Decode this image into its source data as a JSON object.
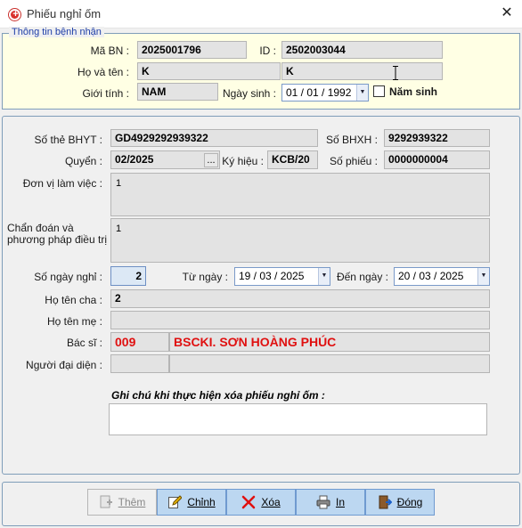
{
  "window": {
    "title": "Phiếu nghỉ ốm",
    "close_glyph": "✕",
    "icon": "medical-cross-icon"
  },
  "patient": {
    "legend": "Thông tin bệnh nhận",
    "ma_bn_label": "Mã BN :",
    "ma_bn": "2025001796",
    "id_label": "ID :",
    "id": "2502003044",
    "ho_ten_label": "Họ và tên :",
    "ho": "K",
    "ten": "K",
    "gioi_tinh_label": "Giới tính :",
    "gioi_tinh": "NAM",
    "ngay_sinh_label": "Ngày sinh :",
    "ngay_sinh": "01 / 01 / 1992",
    "nam_sinh_label": "Năm sinh"
  },
  "details": {
    "so_the_bhyt_label": "Số thẻ BHYT :",
    "so_the_bhyt": "GD4929292939322",
    "so_bhxh_label": "Số BHXH :",
    "so_bhxh": "9292939322",
    "quyen_label": "Quyển :",
    "quyen": "02/2025",
    "dots": "...",
    "ky_hieu_label": "Ký hiệu :",
    "ky_hieu": "KCB/20",
    "so_phieu_label": "Số phiếu :",
    "so_phieu": "0000000004",
    "don_vi_label": "Đơn vị làm việc :",
    "don_vi": "1",
    "chan_doan_label_1": "Chẩn đoán và",
    "chan_doan_label_2": "phương pháp điều trị :",
    "chan_doan": "1",
    "so_ngay_nghi_label": "Số ngày nghỉ :",
    "so_ngay_nghi": "2",
    "tu_ngay_label": "Từ ngày :",
    "tu_ngay": "19 / 03 / 2025",
    "den_ngay_label": "Đến ngày :",
    "den_ngay": "20 / 03 / 2025",
    "ho_ten_cha_label": "Họ tên cha :",
    "ho_ten_cha": "2",
    "ho_ten_me_label": "Họ tên mẹ :",
    "ho_ten_me": "",
    "bac_si_label": "Bác sĩ :",
    "bac_si_ma": "009",
    "bac_si_ten": "BSCKI. SƠN HOÀNG PHÚC",
    "nguoi_dai_dien_label": "Người đại diện :",
    "ghi_chu_label": "Ghi chú khi thực hiện xóa phiếu nghỉ ốm :",
    "ghi_chu": ""
  },
  "buttons": {
    "them": "Thêm",
    "chinh": "Chỉnh",
    "xoa": "Xóa",
    "in": "In",
    "dong": "Đóng"
  },
  "colors": {
    "accent_red": "#e01010",
    "panel_yellow": "#ffffe4",
    "button_blue": "#bcd7f1"
  }
}
